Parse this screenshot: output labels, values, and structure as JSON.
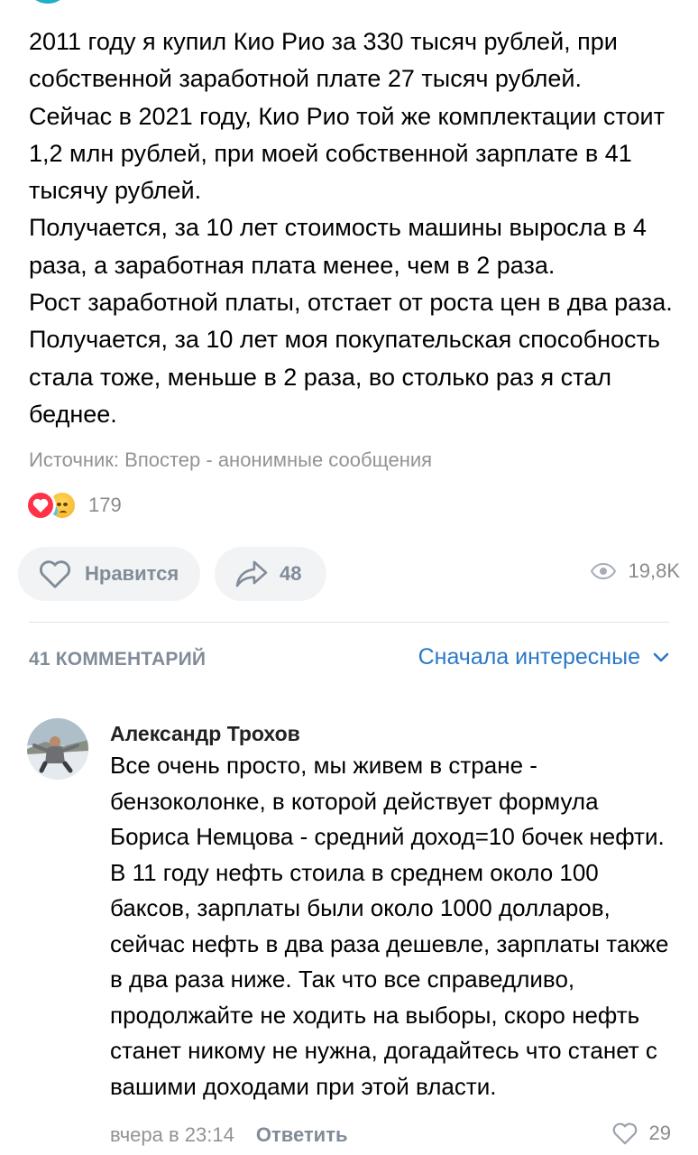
{
  "post": {
    "paragraphs": [
      "2011 году я купил Кио Рио за 330 тысяч рублей, при собственной заработной плате 27 тысяч рублей.",
      "Сейчас в 2021 году, Кио Рио той же комплектации стоит 1,2 млн рублей, при моей собственной зарплате в 41 тысячу рублей.",
      "Получается, за 10 лет стоимость машины выросла в 4 раза, а заработная плата менее, чем в 2 раза.",
      "Рост заработной платы, отстает от роста цен в два раза. Получается, за 10 лет моя покупательская способность стала тоже, меньше в 2 раза, во столько раз я стал беднее."
    ],
    "source": "Источник: Впостер - анонимные сообщения",
    "reactions": {
      "icons": [
        "heart-reaction-icon",
        "crying-face-reaction-icon"
      ],
      "count": "179"
    },
    "actions": {
      "like_label": "Нравится",
      "share_count": "48",
      "views": "19,8K"
    }
  },
  "comments_header": {
    "count_label": "41 КОММЕНТАРИЙ",
    "sort_label": "Сначала интересные"
  },
  "comment": {
    "author": "Александр Трохов",
    "text": "Все очень просто, мы живем в стране - бензоколонке, в которой действует формула Бориса Немцова - средний доход=10 бочек нефти. В 11 году нефть стоила в среднем около 100 баксов, зарплаты были около 1000 долларов, сейчас нефть в два раза дешевле, зарплаты также в два раза ниже. Так что все справедливо, продолжайте не ходить на выборы, скоро нефть станет никому не нужна, догадайтесь что станет с вашими доходами при этой власти.",
    "time": "вчера в 23:14",
    "reply_label": "Ответить",
    "likes": "29"
  },
  "colors": {
    "accent": "#2a78c8",
    "secondary_text": "#818c99",
    "button_bg": "#f2f3f5",
    "heart": "#ff3347"
  }
}
